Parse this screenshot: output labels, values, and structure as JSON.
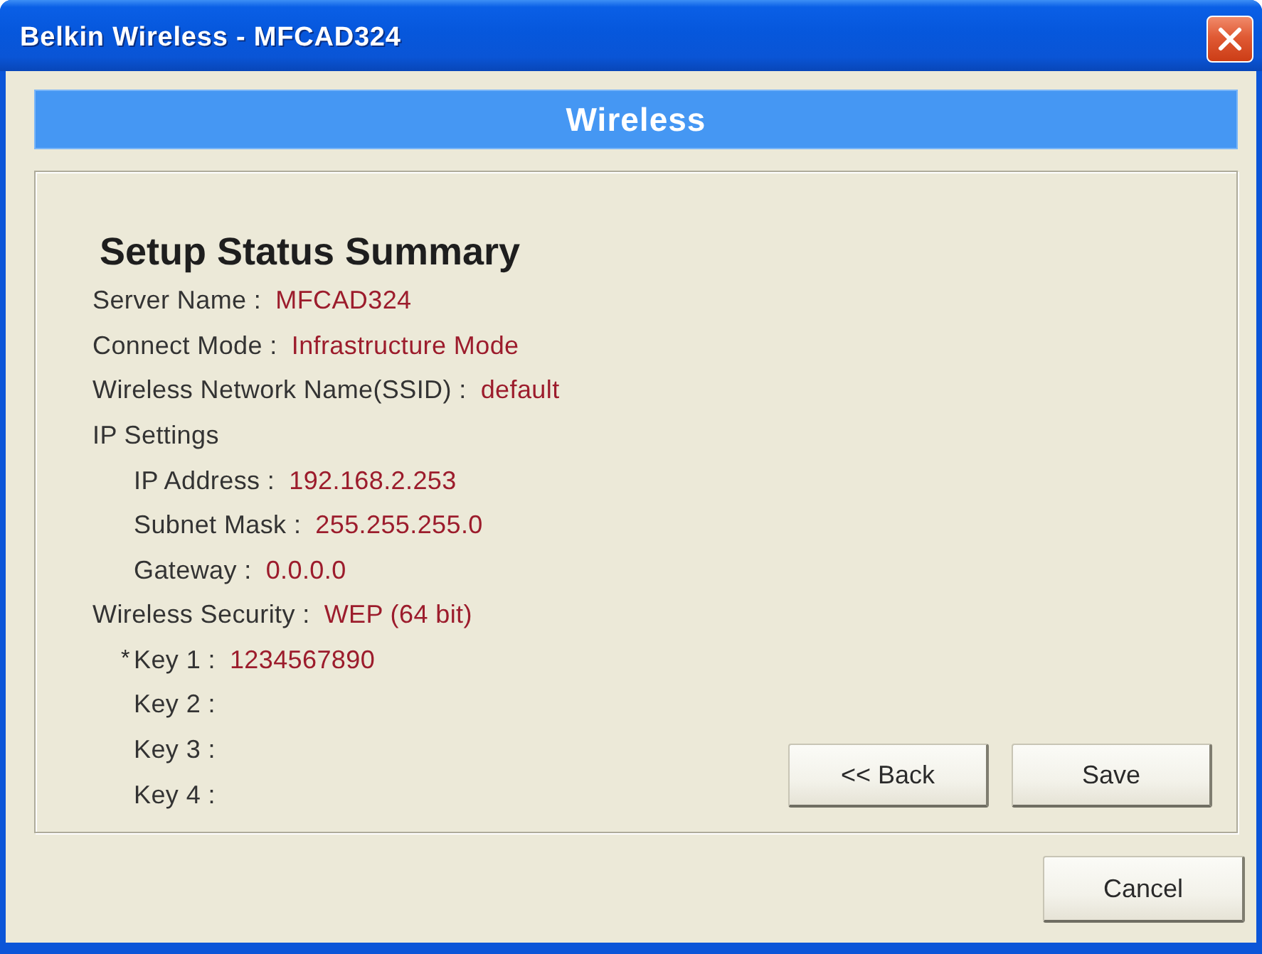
{
  "window": {
    "title": "Belkin Wireless - MFCAD324"
  },
  "header": {
    "title": "Wireless"
  },
  "summary": {
    "heading": "Setup Status Summary",
    "items": [
      {
        "label": "Server Name :",
        "value": "MFCAD324"
      },
      {
        "label": "Connect Mode :",
        "value": "Infrastructure Mode"
      },
      {
        "label": "Wireless Network Name(SSID) :",
        "value": "default"
      },
      {
        "label": "IP Settings",
        "children": [
          {
            "label": "IP Address :",
            "value": "192.168.2.253"
          },
          {
            "label": "Subnet Mask :",
            "value": "255.255.255.0"
          },
          {
            "label": "Gateway :",
            "value": "0.0.0.0"
          }
        ]
      },
      {
        "label": "Wireless Security :",
        "value": "WEP (64 bit)",
        "children": [
          {
            "mark": "*",
            "label": "Key 1 :",
            "value": "1234567890"
          },
          {
            "label": "Key 2 :"
          },
          {
            "label": "Key 3 :"
          },
          {
            "label": "Key 4 :"
          }
        ]
      }
    ]
  },
  "buttons": [
    {
      "label": "<< Back"
    },
    {
      "label": "Save"
    }
  ],
  "footer_buttons": [
    {
      "label": "Cancel"
    }
  ]
}
